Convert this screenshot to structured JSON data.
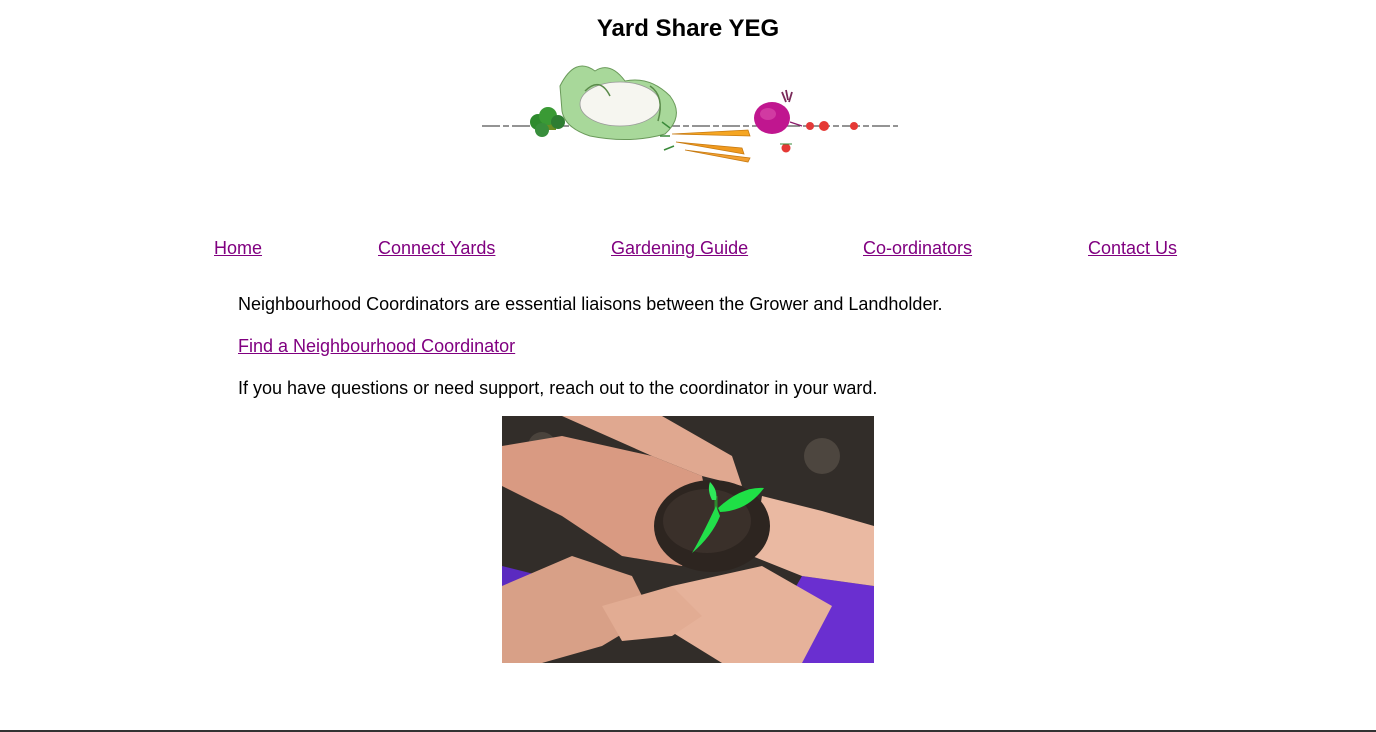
{
  "header": {
    "title": "Yard Share YEG"
  },
  "banner": {
    "icon": "vegetables-illustration"
  },
  "nav": {
    "items": [
      {
        "label": "Home"
      },
      {
        "label": "Connect Yards"
      },
      {
        "label": "Gardening Guide"
      },
      {
        "label": "Co-ordinators"
      },
      {
        "label": "Contact Us"
      }
    ],
    "link_color": "#800080"
  },
  "main": {
    "intro": "Neighbourhood Coordinators are essential liaisons between the Grower and Landholder.",
    "find_link": "Find a Neighbourhood Coordinator",
    "support": "If you have questions or need support, reach out to the coordinator in your ward."
  },
  "photo": {
    "icon": "hands-holding-seedling-photo"
  }
}
